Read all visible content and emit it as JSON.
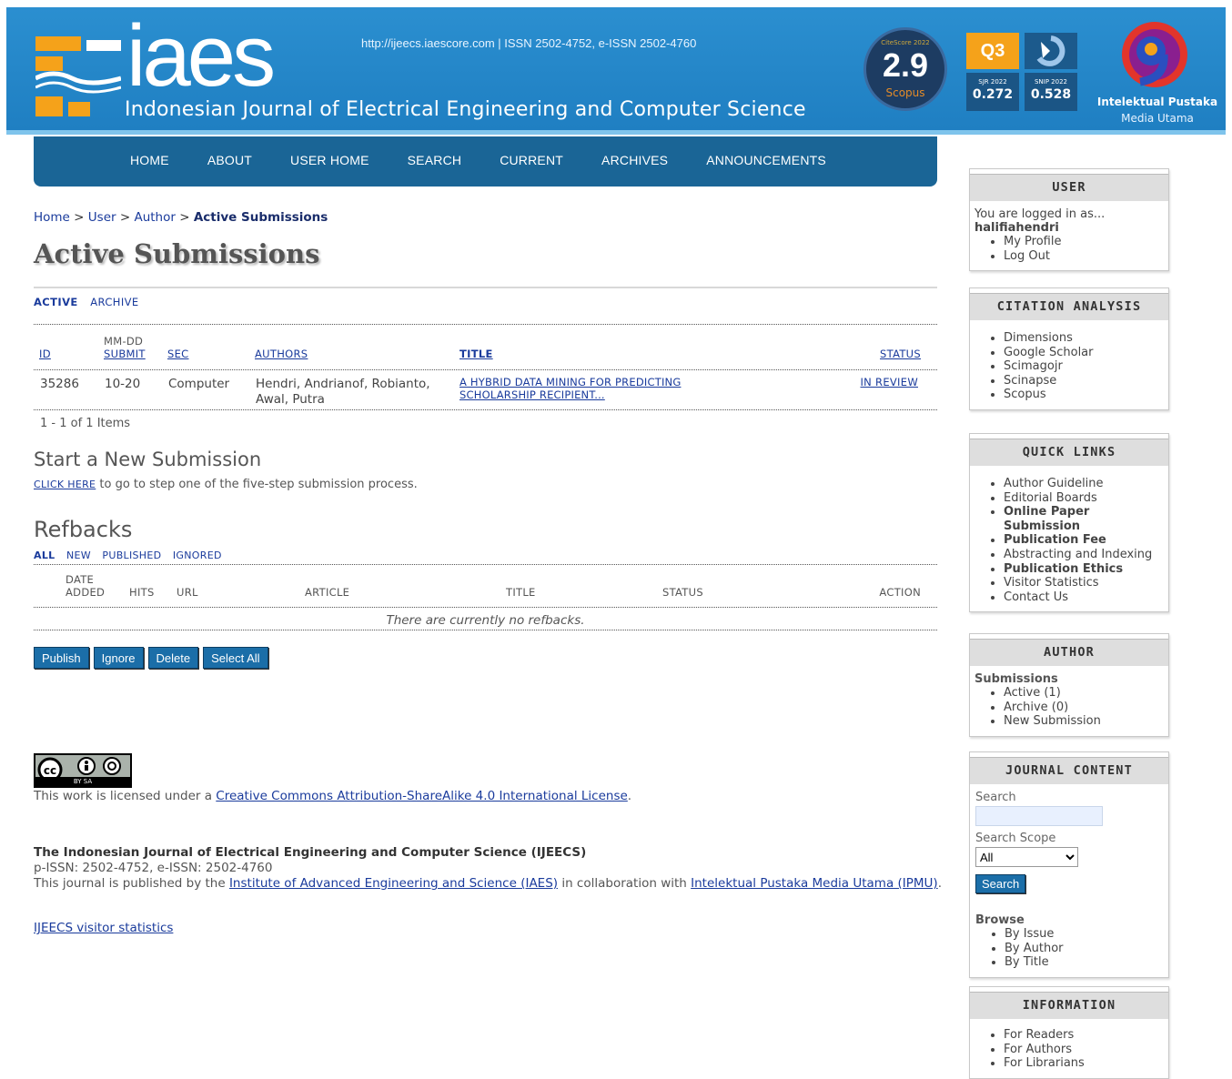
{
  "header": {
    "logo_text": "iaes",
    "journal_name": "Indonesian Journal of Electrical Engineering and Computer Science",
    "url_issn": "http://ijeecs.iaescore.com  |  ISSN 2502-4752, e-ISSN 2502-4760",
    "citescore": {
      "label": "CiteScore 2022",
      "value": "2.9",
      "source": "Scopus"
    },
    "quartile": "Q3",
    "sjr": {
      "label": "SJR 2022",
      "value": "0.272"
    },
    "snip": {
      "label": "SNIP 2022",
      "value": "0.528"
    },
    "publisher_name": "Intelektual Pustaka",
    "publisher_sub": "Media Utama"
  },
  "nav": [
    "HOME",
    "ABOUT",
    "USER HOME",
    "SEARCH",
    "CURRENT",
    "ARCHIVES",
    "ANNOUNCEMENTS"
  ],
  "breadcrumb": {
    "home": "Home",
    "user": "User",
    "author": "Author",
    "current": "Active Submissions",
    "sep": ">"
  },
  "page_title": "Active Submissions",
  "sub_tabs": {
    "active": "ACTIVE",
    "archive": "ARCHIVE"
  },
  "submissions_table": {
    "headers": {
      "id": "ID",
      "date_top": "MM-DD",
      "date_bottom": "SUBMIT",
      "sec": "SEC",
      "authors": "AUTHORS",
      "title": "TITLE",
      "status": "STATUS"
    },
    "row": {
      "id": "35286",
      "date": "10-20",
      "sec": "Computer",
      "authors_line1": "Hendri, Andrianof, Robianto,",
      "authors_line2": "Awal, Putra",
      "title_line1": "A HYBRID DATA MINING FOR PREDICTING",
      "title_line2": "SCHOLARSHIP RECIPIENT...",
      "status": "IN REVIEW"
    },
    "items_count": "1 - 1 of 1 Items"
  },
  "new_submission": {
    "heading": "Start a New Submission",
    "link": "CLICK HERE",
    "text": " to go to step one of the five-step submission process."
  },
  "refbacks": {
    "heading": "Refbacks",
    "tabs": {
      "all": "ALL",
      "new": "NEW",
      "published": "PUBLISHED",
      "ignored": "IGNORED"
    },
    "headers": {
      "date_top": "DATE",
      "date_bottom": "ADDED",
      "hits": "HITS",
      "url": "URL",
      "article": "ARTICLE",
      "title": "TITLE",
      "status": "STATUS",
      "action": "ACTION"
    },
    "empty": "There are currently no refbacks.",
    "buttons": {
      "publish": "Publish",
      "ignore": "Ignore",
      "delete": "Delete",
      "select_all": "Select All"
    }
  },
  "footer": {
    "cc_badge_text": "BY  SA",
    "license_prefix": "This work is licensed under a ",
    "license_link": "Creative Commons Attribution-ShareAlike 4.0 International License",
    "license_suffix": ".",
    "journal_full": "The Indonesian Journal of Electrical Engineering and Computer Science (IJEECS)",
    "issn": "p-ISSN: 2502-4752, e-ISSN: 2502-4760",
    "pub_prefix": "This journal is published by the ",
    "pub_link1": "Institute of Advanced Engineering and Science (IAES)",
    "pub_mid": " in collaboration with ",
    "pub_link2": "Intelektual Pustaka Media Utama (IPMU)",
    "pub_suffix": ".",
    "stats_link": "IJEECS visitor statistics"
  },
  "sidebar": {
    "user": {
      "title": "USER",
      "logged_in": "You are logged in as...",
      "username": "halifiahendri",
      "items": [
        "My Profile",
        "Log Out"
      ]
    },
    "citation": {
      "title": "CITATION ANALYSIS",
      "items": [
        "Dimensions",
        "Google Scholar",
        "Scimagojr",
        "Scinapse",
        "Scopus"
      ]
    },
    "quick_links": {
      "title": "QUICK LINKS",
      "items": [
        "Author Guideline",
        "Editorial Boards",
        "Online Paper Submission",
        "Publication Fee",
        "Abstracting and Indexing",
        "Publication Ethics",
        "Visitor Statistics",
        "Contact Us"
      ]
    },
    "author": {
      "title": "AUTHOR",
      "label": "Submissions",
      "items": [
        "Active (1)",
        "Archive (0)",
        "New Submission"
      ]
    },
    "journal_content": {
      "title": "JOURNAL CONTENT",
      "search_label": "Search",
      "scope_label": "Search Scope",
      "scope_value": "All",
      "search_button": "Search",
      "browse_label": "Browse",
      "browse_items": [
        "By Issue",
        "By Author",
        "By Title"
      ]
    },
    "information": {
      "title": "INFORMATION",
      "items": [
        "For Readers",
        "For Authors",
        "For Librarians"
      ]
    }
  }
}
